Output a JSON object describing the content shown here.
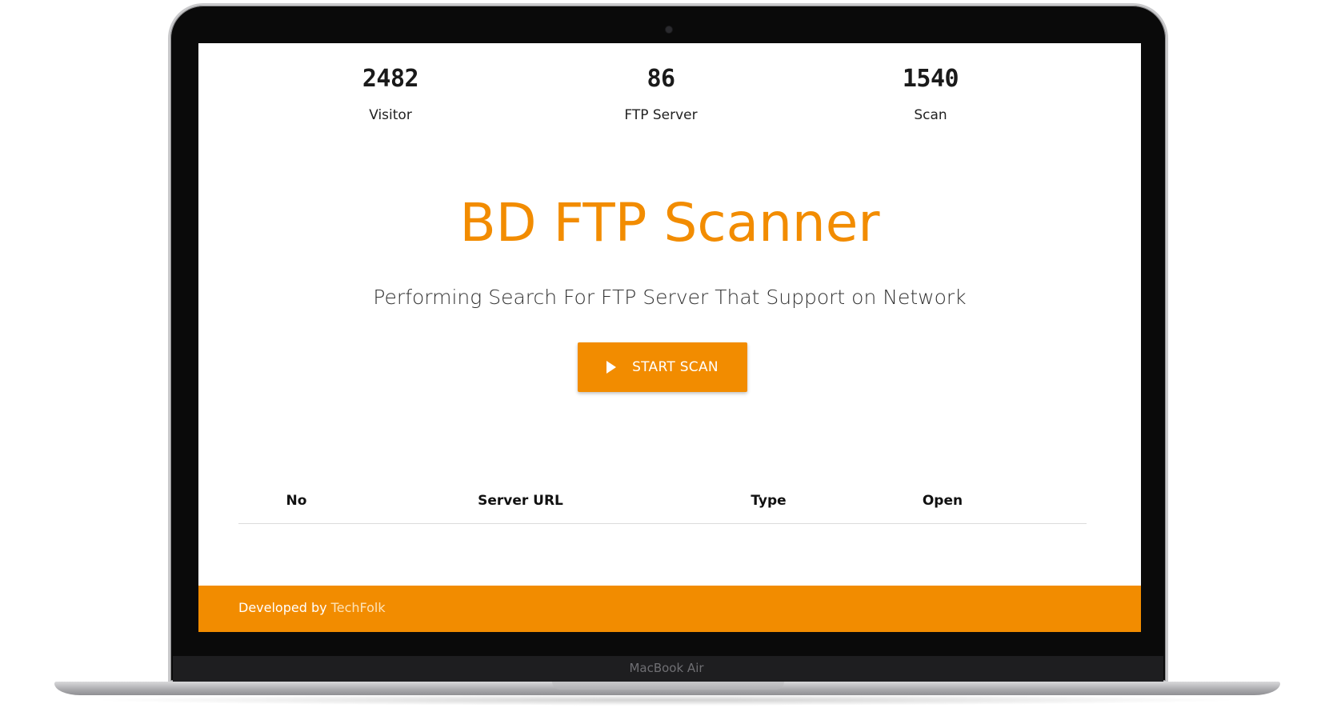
{
  "device": {
    "brand_label": "MacBook Air"
  },
  "stats": [
    {
      "value": "2482",
      "label": "Visitor"
    },
    {
      "value": "86",
      "label": "FTP Server"
    },
    {
      "value": "1540",
      "label": "Scan"
    }
  ],
  "hero": {
    "title": "BD FTP Scanner",
    "subtitle": "Performing Search For FTP Server That Support on Network",
    "button_label": "START SCAN",
    "button_icon": "play-icon"
  },
  "table": {
    "columns": [
      "No",
      "Server URL",
      "Type",
      "Open"
    ],
    "rows": []
  },
  "footer": {
    "prefix": "Developed by",
    "link_text": "TechFolk"
  },
  "colors": {
    "accent": "#f28c00",
    "footer_link": "#fde3b8",
    "text": "#1a1a1a"
  }
}
